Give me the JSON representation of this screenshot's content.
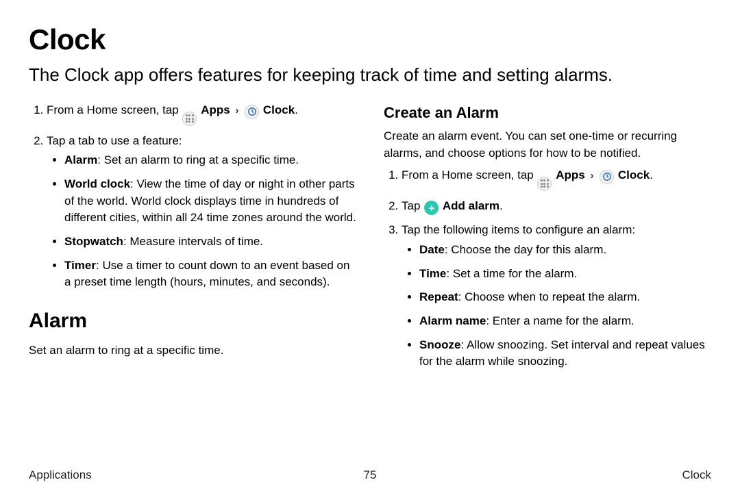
{
  "title": "Clock",
  "intro": "The Clock app offers features for keeping track of time and setting alarms.",
  "left": {
    "step1_prefix": "From a Home screen, tap ",
    "step1_apps": "Apps",
    "step1_chevron": "›",
    "step1_clock": "Clock",
    "step1_period": ".",
    "step2": "Tap a tab to use a feature:",
    "bullets": {
      "alarm_b": "Alarm",
      "alarm_t": ": Set an alarm to ring at a specific time.",
      "world_b": "World clock",
      "world_t": ": View the time of day or night in other parts of the world. World clock displays time in hundreds of different cities, within all 24 time zones around the world.",
      "stop_b": "Stopwatch",
      "stop_t": ": Measure intervals of time.",
      "timer_b": "Timer",
      "timer_t": ": Use a timer to count down to an event based on a preset time length (hours, minutes, and seconds)."
    },
    "section_title": "Alarm",
    "section_desc": "Set an alarm to ring at a specific time."
  },
  "right": {
    "subsection_title": "Create an Alarm",
    "subsection_desc": "Create an alarm event. You can set one-time or recurring alarms, and choose options for how to be notified.",
    "step1_prefix": "From a Home screen, tap ",
    "step1_apps": "Apps",
    "step1_chevron": "›",
    "step1_clock": "Clock",
    "step1_period": ".",
    "step2_prefix": "Tap ",
    "step2_add": "Add alarm",
    "step2_period": ".",
    "step3": "Tap the following items to configure an alarm:",
    "bullets": {
      "date_b": "Date",
      "date_t": ": Choose the day for this alarm.",
      "time_b": "Time",
      "time_t": ": Set a time for the alarm.",
      "repeat_b": "Repeat",
      "repeat_t": ": Choose when to repeat the alarm.",
      "name_b": "Alarm name",
      "name_t": ": Enter a name for the alarm.",
      "snooze_b": "Snooze",
      "snooze_t": ": Allow snoozing. Set interval and repeat values for the alarm while snoozing."
    }
  },
  "footer": {
    "left": "Applications",
    "center": "75",
    "right": "Clock"
  }
}
